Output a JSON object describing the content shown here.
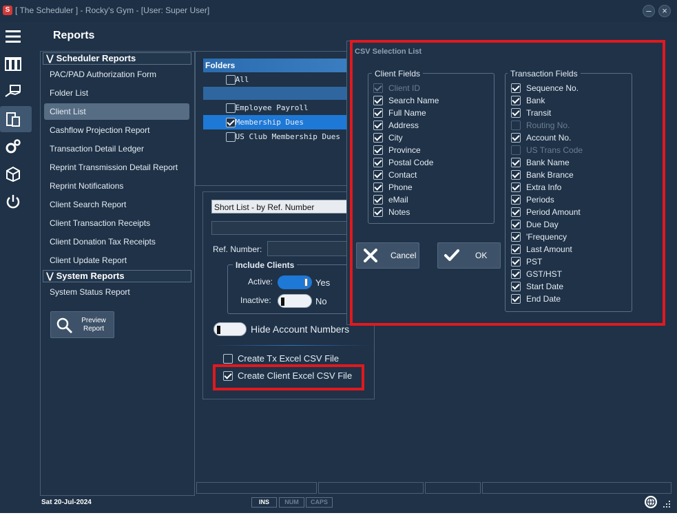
{
  "window": {
    "app_icon_glyph": "S",
    "title": "[ The Scheduler ] - Rocky's Gym - [User: Super User]",
    "minimize_glyph": "–",
    "close_glyph": "×"
  },
  "rail": [
    "hamburger-icon",
    "ledger-icon",
    "hand-money-icon",
    "clipboard-icon",
    "gears-icon",
    "box-icon",
    "power-icon"
  ],
  "reports_title": "Reports",
  "menu": {
    "scheduler_section": "Scheduler Reports",
    "scheduler_items": [
      "PAC/PAD Authorization Form",
      "Folder List",
      "Client List",
      "Cashflow Projection Report",
      "Transaction Detail Ledger",
      "Reprint Transmission Detail Report",
      "Reprint Notifications",
      "Client Search Report",
      "Client Transaction Receipts",
      "Client Donation Tax Receipts",
      "Client Update Report"
    ],
    "active_item": "Client List",
    "system_section": "System Reports",
    "system_items": [
      "System Status Report"
    ],
    "preview_button": "Preview Report"
  },
  "folders": {
    "header": "Folders",
    "items": [
      {
        "label": "All",
        "checked": false
      },
      {
        "label": "Employee Payroll",
        "checked": false
      },
      {
        "label": "Membership Dues",
        "checked": true
      },
      {
        "label": "US Club Membership Dues",
        "checked": false
      }
    ]
  },
  "options": {
    "report_type": "Short List - by Ref. Number",
    "ref_number_label": "Ref. Number:",
    "ref_number_value": "",
    "include_clients_label": "Include Clients",
    "active_label": "Active:",
    "active_state": "Yes",
    "inactive_label": "Inactive:",
    "inactive_state": "No",
    "hide_account_numbers": "Hide Account Numbers",
    "create_tx_csv": "Create Tx  Excel CSV File",
    "create_client_csv": "Create Client  Excel CSV File"
  },
  "status": {
    "date": "Sat  20-Jul-2024",
    "ins": "INS",
    "num": "NUM",
    "caps": "CAPS"
  },
  "csv_dialog": {
    "title": "CSV Selection List",
    "client_fields_label": "Client Fields",
    "client_fields": [
      {
        "label": "Client ID",
        "checked": true,
        "disabled": true
      },
      {
        "label": "Search Name",
        "checked": true,
        "disabled": false
      },
      {
        "label": "Full Name",
        "checked": true,
        "disabled": false
      },
      {
        "label": "Address",
        "checked": true,
        "disabled": false
      },
      {
        "label": "City",
        "checked": true,
        "disabled": false
      },
      {
        "label": "Province",
        "checked": true,
        "disabled": false
      },
      {
        "label": "Postal Code",
        "checked": true,
        "disabled": false
      },
      {
        "label": "Contact",
        "checked": true,
        "disabled": false
      },
      {
        "label": "Phone",
        "checked": true,
        "disabled": false
      },
      {
        "label": "eMail",
        "checked": true,
        "disabled": false
      },
      {
        "label": "Notes",
        "checked": true,
        "disabled": false
      }
    ],
    "transaction_fields_label": "Transaction Fields",
    "transaction_fields": [
      {
        "label": "Sequence No.",
        "checked": true,
        "disabled": false
      },
      {
        "label": "Bank",
        "checked": true,
        "disabled": false
      },
      {
        "label": "Transit",
        "checked": true,
        "disabled": false
      },
      {
        "label": "Routing No.",
        "checked": false,
        "disabled": true
      },
      {
        "label": "Account No.",
        "checked": true,
        "disabled": false
      },
      {
        "label": "US Trans Code",
        "checked": false,
        "disabled": true
      },
      {
        "label": "Bank Name",
        "checked": true,
        "disabled": false
      },
      {
        "label": "Bank Brance",
        "checked": true,
        "disabled": false
      },
      {
        "label": "Extra Info",
        "checked": true,
        "disabled": false
      },
      {
        "label": "Periods",
        "checked": true,
        "disabled": false
      },
      {
        "label": "Period Amount",
        "checked": true,
        "disabled": false
      },
      {
        "label": "Due Day",
        "checked": true,
        "disabled": false
      },
      {
        "label": "'Frequency",
        "checked": true,
        "disabled": false
      },
      {
        "label": "Last Amount",
        "checked": true,
        "disabled": false
      },
      {
        "label": "PST",
        "checked": true,
        "disabled": false
      },
      {
        "label": "GST/HST",
        "checked": true,
        "disabled": false
      },
      {
        "label": "Start Date",
        "checked": true,
        "disabled": false
      },
      {
        "label": "End Date",
        "checked": true,
        "disabled": false
      }
    ],
    "cancel_label": "Cancel",
    "ok_label": "OK"
  },
  "colors": {
    "background": "#1f3247",
    "accent_blue": "#1e78d6",
    "highlight_red": "#e0191f"
  }
}
